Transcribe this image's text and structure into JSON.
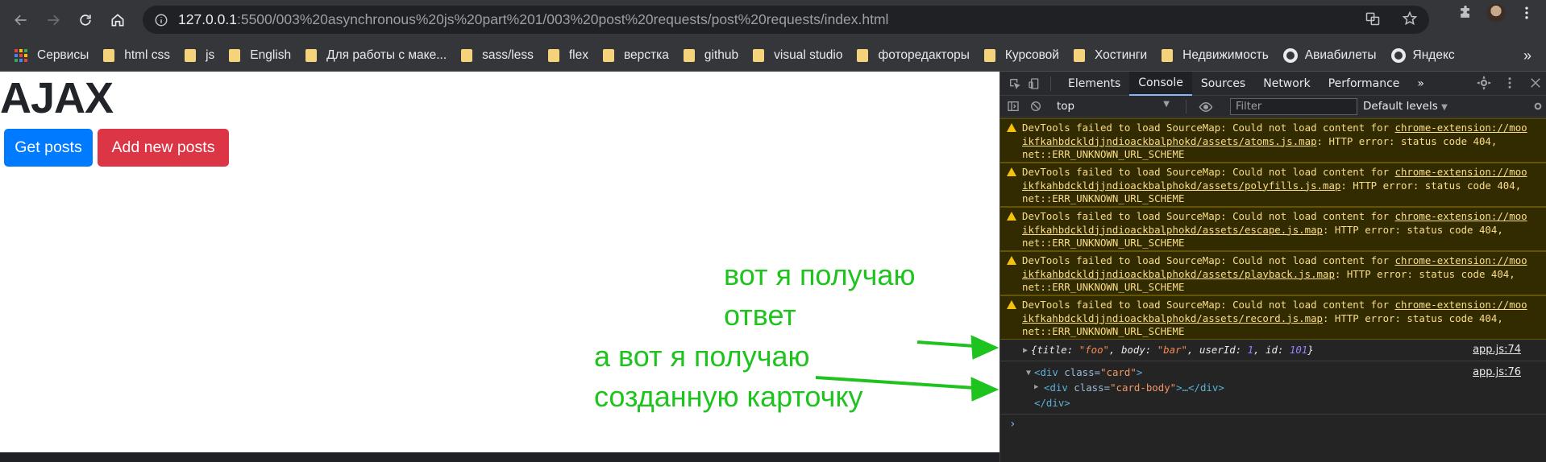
{
  "browser": {
    "url_host": "127.0.0.1",
    "url_rest": ":5500/003%20asynchronous%20js%20part%201/003%20post%20requests/post%20requests/index.html",
    "bookmarks": [
      {
        "label": "Сервисы",
        "icon": "apps-icon"
      },
      {
        "label": "html css",
        "icon": "folder-icon"
      },
      {
        "label": "js",
        "icon": "folder-icon"
      },
      {
        "label": "English",
        "icon": "folder-icon"
      },
      {
        "label": "Для работы с маке...",
        "icon": "folder-icon"
      },
      {
        "label": "sass/less",
        "icon": "folder-icon"
      },
      {
        "label": "flex",
        "icon": "folder-icon"
      },
      {
        "label": "верстка",
        "icon": "folder-icon"
      },
      {
        "label": "github",
        "icon": "folder-icon"
      },
      {
        "label": "visual studio",
        "icon": "folder-icon"
      },
      {
        "label": "фоторедакторы",
        "icon": "folder-icon"
      },
      {
        "label": "Курсовой",
        "icon": "folder-icon"
      },
      {
        "label": "Хостинги",
        "icon": "folder-icon"
      },
      {
        "label": "Недвижимость",
        "icon": "folder-icon"
      },
      {
        "label": "Авиабилеты",
        "icon": "globe-icon"
      },
      {
        "label": "Яндекс",
        "icon": "globe-icon"
      }
    ],
    "bookmarks_more": "»"
  },
  "page": {
    "heading": "AJAX",
    "get_posts_label": "Get posts",
    "add_posts_label": "Add new posts",
    "annotation_1_line1": "вот я получаю",
    "annotation_1_line2": "ответ",
    "annotation_2_line1": "а вот я получаю",
    "annotation_2_line2": "созданную карточку",
    "colors": {
      "primary": "#007bff",
      "danger": "#dc3545",
      "annotation": "#1ec31e"
    }
  },
  "devtools": {
    "tabs": [
      "Elements",
      "Console",
      "Sources",
      "Network",
      "Performance"
    ],
    "active_tab": "Console",
    "more_tabs": "»",
    "context": "top",
    "filter_placeholder": "Filter",
    "levels": "Default levels",
    "warnings": [
      {
        "prefix": "DevTools failed to load SourceMap: Could not load content for ",
        "link1": "chrome-extension://moo",
        "link2": "ikfkahbdckldjjndioackbalphokd/assets/atoms.js.map",
        "suffix": ": HTTP error: status code 404,",
        "line3": "net::ERR_UNKNOWN_URL_SCHEME"
      },
      {
        "prefix": "DevTools failed to load SourceMap: Could not load content for ",
        "link1": "chrome-extension://moo",
        "link2": "ikfkahbdckldjjndioackbalphokd/assets/polyfills.js.map",
        "suffix": ": HTTP error: status code 404,",
        "line3": "net::ERR_UNKNOWN_URL_SCHEME"
      },
      {
        "prefix": "DevTools failed to load SourceMap: Could not load content for ",
        "link1": "chrome-extension://moo",
        "link2": "ikfkahbdckldjjndioackbalphokd/assets/escape.js.map",
        "suffix": ": HTTP error: status code 404,",
        "line3": "net::ERR_UNKNOWN_URL_SCHEME"
      },
      {
        "prefix": "DevTools failed to load SourceMap: Could not load content for ",
        "link1": "chrome-extension://moo",
        "link2": "ikfkahbdckldjjndioackbalphokd/assets/playback.js.map",
        "suffix": ": HTTP error: status code 404,",
        "line3": "net::ERR_UNKNOWN_URL_SCHEME"
      },
      {
        "prefix": "DevTools failed to load SourceMap: Could not load content for ",
        "link1": "chrome-extension://moo",
        "link2": "ikfkahbdckldjjndioackbalphokd/assets/record.js.map",
        "suffix": ": HTTP error: status code 404,",
        "line3": "net::ERR_UNKNOWN_URL_SCHEME"
      }
    ],
    "log_object": {
      "open": "{",
      "title_key": "title",
      "title_val": "\"foo\"",
      "body_key": "body",
      "body_val": "\"bar\"",
      "user_key": "userId",
      "user_val": "1",
      "id_key": "id",
      "id_val": "101",
      "close": "}",
      "source": "app.js:74"
    },
    "log_element": {
      "line1_tag_open": "<div",
      "line1_attr": " class=",
      "line1_val": "\"card\"",
      "line1_close": ">",
      "line2_tag_open": "<div",
      "line2_attr": " class=",
      "line2_val": "\"card-body\"",
      "line2_rest": ">…</div>",
      "line3": "</div>",
      "source": "app.js:76"
    },
    "prompt": "›"
  }
}
